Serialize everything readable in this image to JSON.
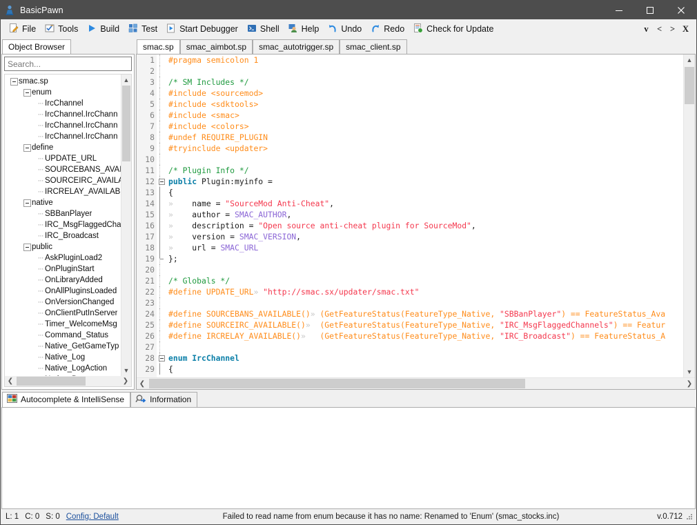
{
  "window": {
    "title": "BasicPawn",
    "app_icon": "pawn-icon",
    "minimize": "─",
    "maximize": "☐",
    "close": "✕"
  },
  "toolbar": {
    "buttons": [
      {
        "label": "File",
        "icon": "file-pencil-icon"
      },
      {
        "label": "Tools",
        "icon": "checkbox-tools-icon"
      },
      {
        "label": "Build",
        "icon": "play-build-icon"
      },
      {
        "label": "Test",
        "icon": "grid-test-icon"
      },
      {
        "label": "Start Debugger",
        "icon": "debug-play-icon"
      },
      {
        "label": "Shell",
        "icon": "shell-console-icon"
      },
      {
        "label": "Help",
        "icon": "help-person-icon"
      },
      {
        "label": "Undo",
        "icon": "undo-arrow-icon"
      },
      {
        "label": "Redo",
        "icon": "redo-arrow-icon"
      },
      {
        "label": "Check for Update",
        "icon": "update-globe-icon"
      }
    ],
    "right_controls": [
      "v",
      "<",
      ">",
      "X"
    ]
  },
  "sidebar": {
    "tab_label": "Object Browser",
    "search": {
      "value": "",
      "placeholder": "Search..."
    },
    "tree": [
      {
        "depth": 0,
        "label": "smac.sp",
        "expander": true
      },
      {
        "depth": 1,
        "label": "enum",
        "expander": true
      },
      {
        "depth": 2,
        "label": "IrcChannel",
        "expander": false
      },
      {
        "depth": 2,
        "label": "IrcChannel.IrcChann",
        "expander": false
      },
      {
        "depth": 2,
        "label": "IrcChannel.IrcChann",
        "expander": false
      },
      {
        "depth": 2,
        "label": "IrcChannel.IrcChann",
        "expander": false
      },
      {
        "depth": 1,
        "label": "define",
        "expander": true
      },
      {
        "depth": 2,
        "label": "UPDATE_URL",
        "expander": false
      },
      {
        "depth": 2,
        "label": "SOURCEBANS_AVAIL",
        "expander": false
      },
      {
        "depth": 2,
        "label": "SOURCEIRC_AVAILA",
        "expander": false
      },
      {
        "depth": 2,
        "label": "IRCRELAY_AVAILABL",
        "expander": false
      },
      {
        "depth": 1,
        "label": "native",
        "expander": true
      },
      {
        "depth": 2,
        "label": "SBBanPlayer",
        "expander": false
      },
      {
        "depth": 2,
        "label": "IRC_MsgFlaggedCha",
        "expander": false
      },
      {
        "depth": 2,
        "label": "IRC_Broadcast",
        "expander": false
      },
      {
        "depth": 1,
        "label": "public",
        "expander": true
      },
      {
        "depth": 2,
        "label": "AskPluginLoad2",
        "expander": false
      },
      {
        "depth": 2,
        "label": "OnPluginStart",
        "expander": false
      },
      {
        "depth": 2,
        "label": "OnLibraryAdded",
        "expander": false
      },
      {
        "depth": 2,
        "label": "OnAllPluginsLoaded",
        "expander": false
      },
      {
        "depth": 2,
        "label": "OnVersionChanged",
        "expander": false
      },
      {
        "depth": 2,
        "label": "OnClientPutInServer",
        "expander": false
      },
      {
        "depth": 2,
        "label": "Timer_WelcomeMsg",
        "expander": false
      },
      {
        "depth": 2,
        "label": "Command_Status",
        "expander": false
      },
      {
        "depth": 2,
        "label": "Native_GetGameTyp",
        "expander": false
      },
      {
        "depth": 2,
        "label": "Native_Log",
        "expander": false
      },
      {
        "depth": 2,
        "label": "Native_LogAction",
        "expander": false
      },
      {
        "depth": 2,
        "label": "Native_Ban",
        "expander": false
      }
    ]
  },
  "editor": {
    "tabs": [
      {
        "label": "smac.sp",
        "active": true
      },
      {
        "label": "smac_aimbot.sp",
        "active": false
      },
      {
        "label": "smac_autotrigger.sp",
        "active": false
      },
      {
        "label": "smac_client.sp",
        "active": false
      }
    ],
    "lines": [
      {
        "n": 1,
        "fold": "none",
        "tokens": [
          {
            "t": "#pragma semicolon 1",
            "c": "pre"
          }
        ]
      },
      {
        "n": 2,
        "fold": "none",
        "tokens": []
      },
      {
        "n": 3,
        "fold": "none",
        "tokens": [
          {
            "t": "/* SM Includes */",
            "c": "cmt"
          }
        ]
      },
      {
        "n": 4,
        "fold": "none",
        "tokens": [
          {
            "t": "#include <sourcemod>",
            "c": "pre"
          }
        ]
      },
      {
        "n": 5,
        "fold": "none",
        "tokens": [
          {
            "t": "#include <sdktools>",
            "c": "pre"
          }
        ]
      },
      {
        "n": 6,
        "fold": "none",
        "tokens": [
          {
            "t": "#include <smac>",
            "c": "pre"
          }
        ]
      },
      {
        "n": 7,
        "fold": "none",
        "tokens": [
          {
            "t": "#include <colors>",
            "c": "pre"
          }
        ]
      },
      {
        "n": 8,
        "fold": "none",
        "tokens": [
          {
            "t": "#undef REQUIRE_PLUGIN",
            "c": "pre"
          }
        ]
      },
      {
        "n": 9,
        "fold": "none",
        "tokens": [
          {
            "t": "#tryinclude <updater>",
            "c": "pre"
          }
        ]
      },
      {
        "n": 10,
        "fold": "none",
        "tokens": []
      },
      {
        "n": 11,
        "fold": "none",
        "tokens": [
          {
            "t": "/* Plugin Info */",
            "c": "cmt"
          }
        ]
      },
      {
        "n": 12,
        "fold": "box",
        "tokens": [
          {
            "t": "public",
            "c": "key"
          },
          {
            "t": " Plugin:myinfo =",
            "c": "txt"
          }
        ]
      },
      {
        "n": 13,
        "fold": "bar",
        "tokens": [
          {
            "t": "{",
            "c": "txt"
          }
        ]
      },
      {
        "n": 14,
        "fold": "bar",
        "tokens": [
          {
            "t": "»",
            "c": "tab"
          },
          {
            "t": "    name = ",
            "c": "txt"
          },
          {
            "t": "\"SourceMod Anti-Cheat\"",
            "c": "str"
          },
          {
            "t": ",",
            "c": "txt"
          }
        ]
      },
      {
        "n": 15,
        "fold": "bar",
        "tokens": [
          {
            "t": "»",
            "c": "tab"
          },
          {
            "t": "    author = ",
            "c": "txt"
          },
          {
            "t": "SMAC_AUTHOR",
            "c": "con"
          },
          {
            "t": ",",
            "c": "txt"
          }
        ]
      },
      {
        "n": 16,
        "fold": "bar",
        "tokens": [
          {
            "t": "»",
            "c": "tab"
          },
          {
            "t": "    description = ",
            "c": "txt"
          },
          {
            "t": "\"Open source anti-cheat plugin for SourceMod\"",
            "c": "str"
          },
          {
            "t": ",",
            "c": "txt"
          }
        ]
      },
      {
        "n": 17,
        "fold": "bar",
        "tokens": [
          {
            "t": "»",
            "c": "tab"
          },
          {
            "t": "    version = ",
            "c": "txt"
          },
          {
            "t": "SMAC_VERSION",
            "c": "con"
          },
          {
            "t": ",",
            "c": "txt"
          }
        ]
      },
      {
        "n": 18,
        "fold": "bar",
        "tokens": [
          {
            "t": "»",
            "c": "tab"
          },
          {
            "t": "    url = ",
            "c": "txt"
          },
          {
            "t": "SMAC_URL",
            "c": "con"
          }
        ]
      },
      {
        "n": 19,
        "fold": "end",
        "tokens": [
          {
            "t": "};",
            "c": "txt"
          }
        ]
      },
      {
        "n": 20,
        "fold": "none",
        "tokens": []
      },
      {
        "n": 21,
        "fold": "none",
        "tokens": [
          {
            "t": "/* Globals */",
            "c": "cmt"
          }
        ]
      },
      {
        "n": 22,
        "fold": "none",
        "tokens": [
          {
            "t": "#define UPDATE_URL",
            "c": "pre"
          },
          {
            "t": "»",
            "c": "tab"
          },
          {
            "t": " ",
            "c": "txt"
          },
          {
            "t": "\"http://smac.sx/updater/smac.txt\"",
            "c": "str"
          }
        ]
      },
      {
        "n": 23,
        "fold": "none",
        "tokens": []
      },
      {
        "n": 24,
        "fold": "none",
        "tokens": [
          {
            "t": "#define SOURCEBANS_AVAILABLE()",
            "c": "pre"
          },
          {
            "t": "»",
            "c": "tab"
          },
          {
            "t": " (GetFeatureStatus(FeatureType_Native, ",
            "c": "pre"
          },
          {
            "t": "\"SBBanPlayer\"",
            "c": "str"
          },
          {
            "t": ") == FeatureStatus_Ava",
            "c": "pre"
          }
        ]
      },
      {
        "n": 25,
        "fold": "none",
        "tokens": [
          {
            "t": "#define SOURCEIRC_AVAILABLE()",
            "c": "pre"
          },
          {
            "t": "»",
            "c": "tab"
          },
          {
            "t": "  (GetFeatureStatus(FeatureType_Native, ",
            "c": "pre"
          },
          {
            "t": "\"IRC_MsgFlaggedChannels\"",
            "c": "str"
          },
          {
            "t": ") == Featur",
            "c": "pre"
          }
        ]
      },
      {
        "n": 26,
        "fold": "none",
        "tokens": [
          {
            "t": "#define IRCRELAY_AVAILABLE()",
            "c": "pre"
          },
          {
            "t": "»",
            "c": "tab"
          },
          {
            "t": "   (GetFeatureStatus(FeatureType_Native, ",
            "c": "pre"
          },
          {
            "t": "\"IRC_Broadcast\"",
            "c": "str"
          },
          {
            "t": ") == FeatureStatus_A",
            "c": "pre"
          }
        ]
      },
      {
        "n": 27,
        "fold": "none",
        "tokens": []
      },
      {
        "n": 28,
        "fold": "box",
        "tokens": [
          {
            "t": "enum",
            "c": "key"
          },
          {
            "t": " ",
            "c": "txt"
          },
          {
            "t": "IrcChannel",
            "c": "key"
          }
        ]
      },
      {
        "n": 29,
        "fold": "bar",
        "tokens": [
          {
            "t": "{",
            "c": "txt"
          }
        ]
      }
    ]
  },
  "bottom_panel": {
    "tabs": [
      {
        "label": "Autocomplete & IntelliSense",
        "icon": "autocomplete-icon",
        "active": true
      },
      {
        "label": "Information",
        "icon": "magnifier-info-icon",
        "active": false
      }
    ]
  },
  "statusbar": {
    "line": "L: 1",
    "column": "C: 0",
    "selection": "S: 0",
    "config_link": "Config: Default",
    "message": "Failed to read name from enum because it has no name: Renamed to 'Enum' (smac_stocks.inc)",
    "version": "v.0.712"
  },
  "colors": {
    "titlebar_bg": "#4d4d4d",
    "chrome_bg": "#f0f0f0",
    "editor_bg": "#ffffff",
    "preprocessor": "#ff8c1a",
    "comment": "#1f9a3f",
    "string": "#f4374d",
    "keyword": "#0b7fa8",
    "constant": "#8b66d6",
    "link": "#1b4f9c"
  }
}
